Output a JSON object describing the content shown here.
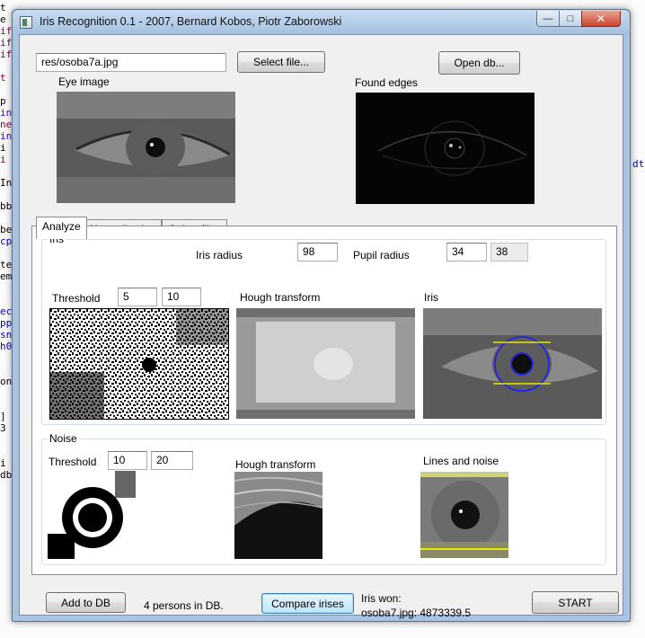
{
  "window": {
    "title": "Iris Recognition 0.1 - 2007, Bernard Kobos, Piotr Zaborowski",
    "controls": {
      "minimize": "—",
      "maximize": "□",
      "close": "✕"
    }
  },
  "top": {
    "file_path": "res/osoba7a.jpg",
    "select_file_label": "Select file...",
    "open_db_label": "Open db...",
    "eye_image_label": "Eye image",
    "found_edges_label": "Found edges"
  },
  "tabs": [
    "Analyze",
    "Normalization",
    "Gabor filter"
  ],
  "iris_group": {
    "title": "Iris",
    "iris_radius_label": "Iris radius",
    "iris_radius_value": "98",
    "pupil_radius_label": "Pupil radius",
    "pupil_radius_value": "34",
    "pupil_radius_value2": "38",
    "threshold_label": "Threshold",
    "threshold_low": "5",
    "threshold_high": "10",
    "hough_label": "Hough transform",
    "iris_image_label": "Iris"
  },
  "noise_group": {
    "title": "Noise",
    "threshold_label": "Threshold",
    "threshold_low": "10",
    "threshold_high": "20",
    "hough_label": "Hough transform",
    "lines_noise_label": "Lines and noise"
  },
  "bottom": {
    "add_to_db_label": "Add to DB",
    "persons_in_db": "4 persons in DB.",
    "compare_label": "Compare irises",
    "iris_won_label": "Iris won:",
    "iris_won_value": "osoba7.jpg: 4873339.5",
    "start_label": "START"
  },
  "background_editor": {
    "left_fragments": [
      "t",
      "e",
      "if",
      "if",
      "if",
      "",
      "t",
      "",
      "p",
      "in",
      "ne",
      "in",
      "i",
      "i",
      "",
      "In",
      "",
      "bb",
      "",
      "be",
      "cp",
      "",
      "te",
      "em",
      "",
      "",
      "ec",
      "pp",
      "sn",
      "h0",
      "",
      "",
      "on",
      "",
      "",
      "]",
      "3",
      "",
      "",
      "i",
      "db"
    ],
    "right_fragment": "dt"
  },
  "colors": {
    "window_frame": "#a9c4e2",
    "client_bg": "#f0f0f0",
    "iris_circle": "#1a1aff",
    "iris_lines": "#e8e800"
  },
  "icons": [
    "app-icon",
    "minimize-icon",
    "maximize-icon",
    "close-icon"
  ]
}
